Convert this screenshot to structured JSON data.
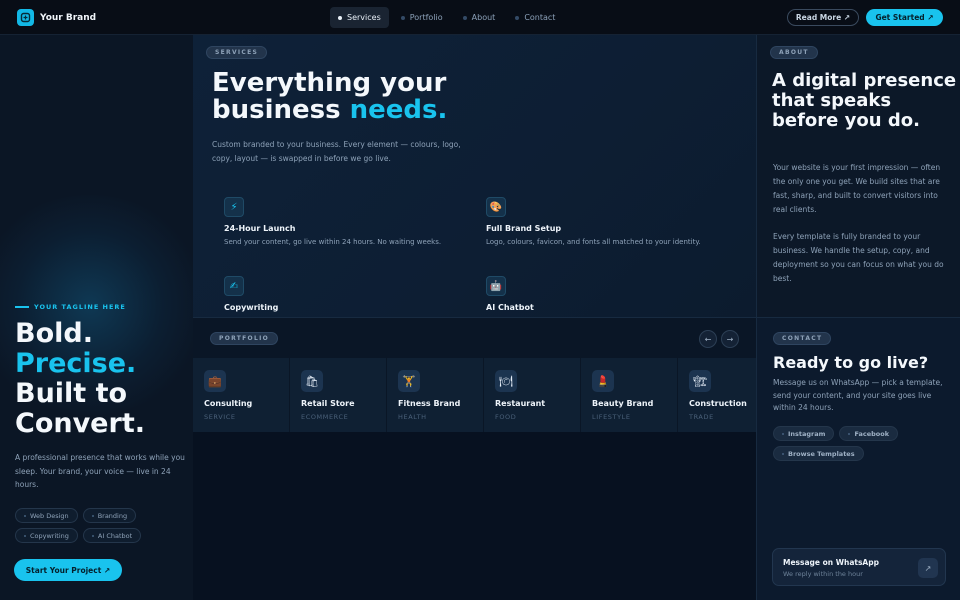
{
  "nav": {
    "brand": "Your Brand",
    "links": [
      {
        "label": "Services",
        "active": true
      },
      {
        "label": "Portfolio",
        "active": false
      },
      {
        "label": "About",
        "active": false
      },
      {
        "label": "Contact",
        "active": false
      }
    ],
    "read_more": "Read More ↗",
    "get_started": "Get Started ↗"
  },
  "hero": {
    "tagline": "YOUR TAGLINE HERE",
    "title_1": "Bold.",
    "title_2": "Precise.",
    "title_3": "Built to",
    "title_4": "Convert.",
    "description": "A professional presence that works while you sleep. Your brand, your voice — live in 24 hours.",
    "chips": [
      "Web Design",
      "Branding",
      "Copywriting",
      "AI Chatbot"
    ],
    "cta": "Start Your Project ↗"
  },
  "services": {
    "badge": "SERVICES",
    "title_line1": "Everything your",
    "title_line2_plain": "business ",
    "title_line2_accent": "needs.",
    "description": "Custom branded to your business. Every element — colours, logo, copy, layout — is swapped in before we go live.",
    "features": [
      {
        "icon": "⚡",
        "icon_name": "lightning-icon",
        "title": "24-Hour Launch",
        "desc": "Send your content, go live within 24 hours. No waiting weeks."
      },
      {
        "icon": "🎨",
        "icon_name": "palette-icon",
        "title": "Full Brand Setup",
        "desc": "Logo, colours, favicon, and fonts all matched to your identity."
      },
      {
        "icon": "✍",
        "icon_name": "writing-hand-icon",
        "title": "Copywriting",
        "desc": ""
      },
      {
        "icon": "🤖",
        "icon_name": "robot-icon",
        "title": "AI Chatbot",
        "desc": ""
      }
    ]
  },
  "portfolio": {
    "badge": "PORTFOLIO",
    "prev": "←",
    "next": "→",
    "cards": [
      {
        "icon": "💼",
        "icon_name": "briefcase-icon",
        "name": "Consulting",
        "category": "SERVICE"
      },
      {
        "icon": "🛍",
        "icon_name": "shopping-bags-icon",
        "name": "Retail Store",
        "category": "ECOMMERCE"
      },
      {
        "icon": "🏋",
        "icon_name": "weightlifter-icon",
        "name": "Fitness Brand",
        "category": "HEALTH"
      },
      {
        "icon": "🍽",
        "icon_name": "plate-icon",
        "name": "Restaurant",
        "category": "FOOD"
      },
      {
        "icon": "💄",
        "icon_name": "lipstick-icon",
        "name": "Beauty Brand",
        "category": "LIFESTYLE"
      },
      {
        "icon": "🏗",
        "icon_name": "construction-icon",
        "name": "Construction",
        "category": "TRADE"
      }
    ]
  },
  "about": {
    "badge": "ABOUT",
    "title": "A digital presence that speaks before you do.",
    "para1": "Your website is your first impression — often the only one you get. We build sites that are fast, sharp, and built to convert visitors into real clients.",
    "para2": "Every template is fully branded to your business. We handle the setup, copy, and deployment so you can focus on what you do best."
  },
  "contact": {
    "badge": "CONTACT",
    "title": "Ready to go live?",
    "description": "Message us on WhatsApp — pick a template, send your content, and your site goes live within 24 hours.",
    "chips": [
      "Instagram",
      "Facebook",
      "Browse Templates"
    ],
    "whatsapp_title": "Message on WhatsApp",
    "whatsapp_sub": "We reply within the hour",
    "whatsapp_arrow": "↗"
  },
  "colors": {
    "accent": "#19c3ee",
    "background": "#07111f"
  }
}
